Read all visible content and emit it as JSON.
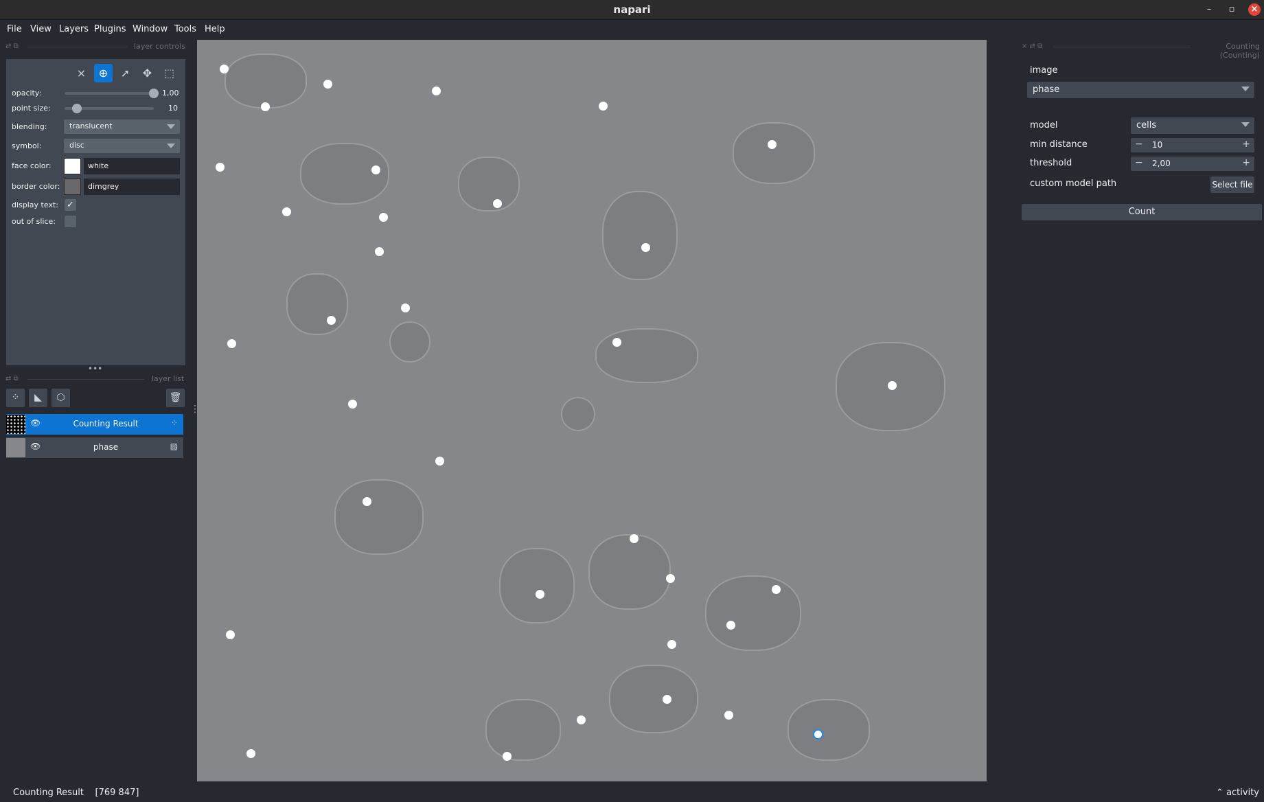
{
  "window": {
    "title": "napari",
    "minimize": "–",
    "restore": "▫",
    "close": "×"
  },
  "menu": [
    "File",
    "View",
    "Layers",
    "Plugins",
    "Window",
    "Tools",
    "Help"
  ],
  "layer_controls": {
    "header": "layer controls",
    "mode_buttons": [
      "×",
      "⊕",
      "➚",
      "✥",
      "⬚"
    ],
    "opacity_label": "opacity:",
    "opacity_value": "1,00",
    "opacity_fraction": 1.0,
    "point_size_label": "point size:",
    "point_size_value": "10",
    "blending_label": "blending:",
    "blending_value": "translucent",
    "symbol_label": "symbol:",
    "symbol_value": "disc",
    "face_color_label": "face color:",
    "face_color_value": "white",
    "face_color_hex": "#ffffff",
    "border_color_label": "border color:",
    "border_color_value": "dimgrey",
    "border_color_hex": "#696969",
    "display_text_label": "display text:",
    "display_text_checked": true,
    "out_of_slice_label": "out of slice:",
    "out_of_slice_checked": false
  },
  "layer_list": {
    "header": "layer list",
    "layers": [
      {
        "name": "Counting Result",
        "type_icon": "points-icon",
        "selected": true,
        "visible": true
      },
      {
        "name": "phase",
        "type_icon": "image-icon",
        "selected": false,
        "visible": true
      }
    ]
  },
  "right_panel": {
    "header": "Counting (Counting)",
    "image_label": "image",
    "image_value": "phase",
    "model_label": "model",
    "model_value": "cells",
    "min_distance_label": "min distance",
    "min_distance_value": "10",
    "threshold_label": "threshold",
    "threshold_value": "2,00",
    "custom_model_path_label": "custom model path",
    "custom_model_path_value": "",
    "select_file_label": "Select file",
    "count_label": "Count"
  },
  "status": {
    "text": "Counting Result    [769 847]",
    "activity": "⌃ activity"
  },
  "colors": {
    "accent": "#0e74d1",
    "panel": "#414851",
    "background": "#262930"
  }
}
